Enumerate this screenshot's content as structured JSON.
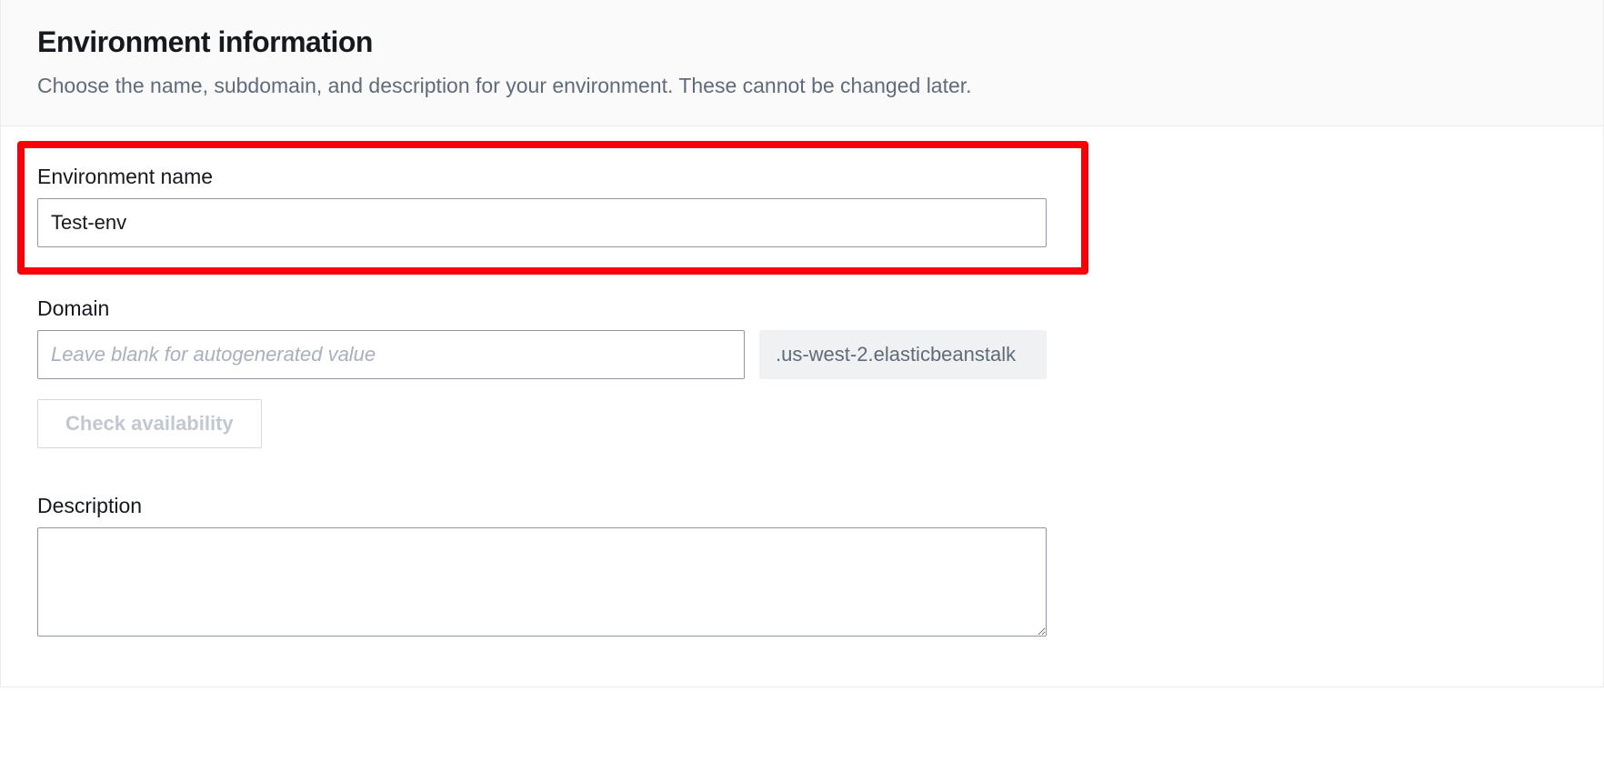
{
  "header": {
    "title": "Environment information",
    "description": "Choose the name, subdomain, and description for your environment. These cannot be changed later."
  },
  "fields": {
    "env_name": {
      "label": "Environment name",
      "value": "Test-env"
    },
    "domain": {
      "label": "Domain",
      "value": "",
      "placeholder": "Leave blank for autogenerated value",
      "suffix": ".us-west-2.elasticbeanstalk",
      "check_button": "Check availability"
    },
    "description": {
      "label": "Description",
      "value": ""
    }
  }
}
